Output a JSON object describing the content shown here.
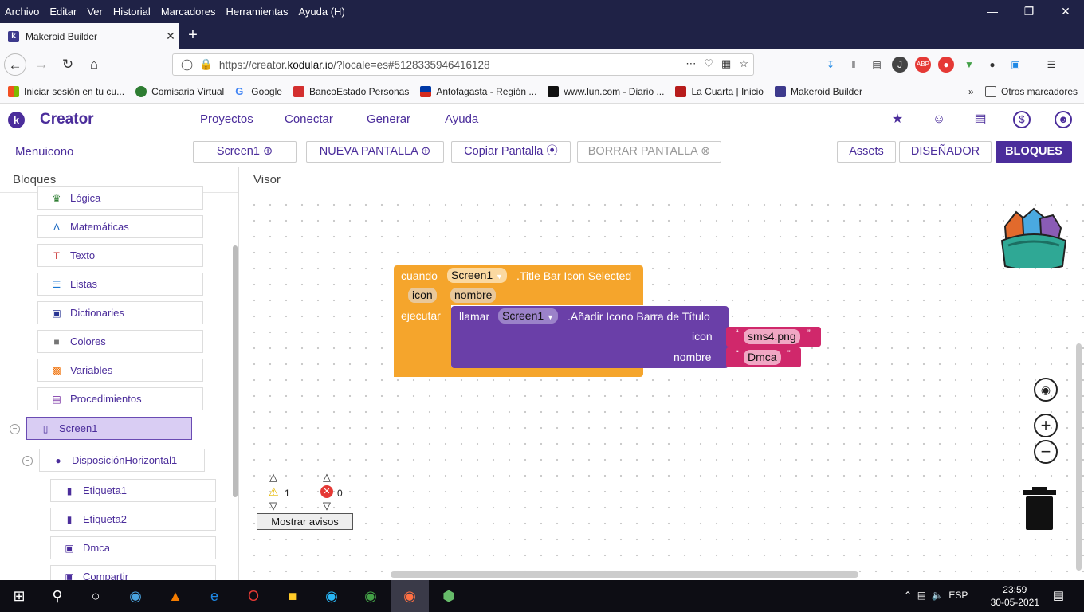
{
  "menubar": {
    "items": [
      "Archivo",
      "Editar",
      "Ver",
      "Historial",
      "Marcadores",
      "Herramientas",
      "Ayuda (H)"
    ]
  },
  "tab": {
    "title": "Makeroid Builder"
  },
  "url": {
    "prefix": "https://creator.",
    "domain": "kodular.io",
    "rest": "/?locale=es#5128335946416128"
  },
  "bookmarks": [
    {
      "label": "Iniciar sesión en tu cu...",
      "color": "#0078d7"
    },
    {
      "label": "Comisaria Virtual",
      "color": "#2e7d32"
    },
    {
      "label": "Google",
      "color": "#4285f4"
    },
    {
      "label": "BancoEstado Personas",
      "color": "#d32f2f"
    },
    {
      "label": "Antofagasta - Región ...",
      "color": "#c62828"
    },
    {
      "label": "www.lun.com - Diario ...",
      "color": "#111111"
    },
    {
      "label": "La Cuarta | Inicio",
      "color": "#b71c1c"
    },
    {
      "label": "Makeroid Builder",
      "color": "#3d3a8c"
    }
  ],
  "bookmarks_other": "Otros marcadores",
  "creator": {
    "brand": "Creator",
    "nav": [
      "Proyectos",
      "Conectar",
      "Generar",
      "Ayuda"
    ]
  },
  "toolbar": {
    "project": "Menuicono",
    "screen": "Screen1",
    "nueva": "NUEVA PANTALLA",
    "copiar": "Copiar Pantalla",
    "borrar": "BORRAR PANTALLA",
    "assets": "Assets",
    "disenador": "DISEÑADOR",
    "bloques": "BLOQUES"
  },
  "left": {
    "title": "Bloques",
    "builtins": [
      {
        "label": "Lógica",
        "color": "#2e7d32"
      },
      {
        "label": "Matemáticas",
        "color": "#1565c0"
      },
      {
        "label": "Texto",
        "color": "#c62828"
      },
      {
        "label": "Listas",
        "color": "#1976d2"
      },
      {
        "label": "Dictionaries",
        "color": "#283593"
      },
      {
        "label": "Colores",
        "color": "#757575"
      },
      {
        "label": "Variables",
        "color": "#ef6c00"
      },
      {
        "label": "Procedimientos",
        "color": "#6a1b9a"
      }
    ],
    "screen": "Screen1",
    "disposicion": "DisposiciónHorizontal1",
    "children": [
      "Etiqueta1",
      "Etiqueta2",
      "Dmca"
    ],
    "partial": "Compartir"
  },
  "viewer": {
    "title": "Visor",
    "event": {
      "cuando": "cuando",
      "component": "Screen1",
      "event_name": ".Title Bar Icon Selected",
      "param1": "icon",
      "param2": "nombre",
      "ejecutar": "ejecutar"
    },
    "call": {
      "llamar": "llamar",
      "component": "Screen1",
      "method": ".Añadir Icono Barra de Título",
      "arg1_label": "icon",
      "arg1_value": "sms4.png",
      "arg2_label": "nombre",
      "arg2_value": "Dmca"
    },
    "warnings": "1",
    "errors": "0",
    "show_warnings": "Mostrar avisos"
  },
  "taskbar": {
    "lang": "ESP",
    "time": "23:59",
    "date": "30-05-2021"
  }
}
